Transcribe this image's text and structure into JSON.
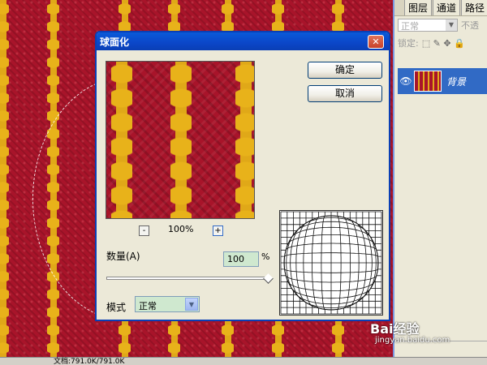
{
  "dialog": {
    "title": "球面化",
    "close_label": "✕",
    "ok_label": "确定",
    "cancel_label": "取消",
    "zoom_minus": "-",
    "zoom_plus": "+",
    "zoom_value": "100%",
    "amount_label": "数量(A)",
    "amount_value": "100",
    "amount_unit": "%",
    "amount_slider_fraction": 1.0,
    "mode_label": "模式",
    "mode_value": "正常"
  },
  "layers_panel": {
    "tabs": [
      "图层",
      "通道",
      "路径"
    ],
    "blend_mode": "正常",
    "opacity_label": "不透",
    "lock_label": "锁定:",
    "layer_name": "背景"
  },
  "status_bar": {
    "doc_info": "文档:791.0K/791.0K"
  },
  "watermark": {
    "brand": "Bai经验",
    "url": "jingyan.baidu.com"
  },
  "colors": {
    "canvas_red": "#a8142a",
    "stripe_gold": "#e0a818",
    "title_blue": "#0b46c8"
  }
}
